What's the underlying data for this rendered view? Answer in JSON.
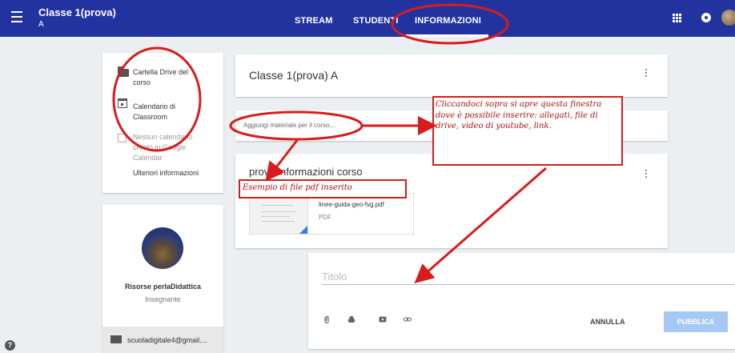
{
  "topbar": {
    "class_name": "Classe 1(prova)",
    "section": "A",
    "tabs": [
      {
        "label": "STREAM"
      },
      {
        "label": "STUDENTI"
      },
      {
        "label": "INFORMAZIONI",
        "active": true
      }
    ],
    "color": "#2233a0"
  },
  "sidebar": {
    "items": [
      {
        "label": "Cartella Drive del corso",
        "icon": "folder-icon"
      },
      {
        "label": "Calendario di Classroom",
        "icon": "calendar-icon"
      },
      {
        "label": "Nessun calendario creato in Google Calendar",
        "icon": "external-link-icon"
      },
      {
        "label": "Ulteriori informazioni"
      }
    ]
  },
  "teacher": {
    "name": "Risorse perlaDidattica",
    "role": "Insegnante",
    "email": "scuoladigitale4@gmail...."
  },
  "main": {
    "title": "Classe 1(prova) A",
    "add_placeholder": "Aggiungi materiale per il corso...",
    "info_title": "prova informazioni corso",
    "attachment": {
      "name": "linee-guida-geo-fvg.pdf",
      "type": "PDF"
    }
  },
  "compose": {
    "title_placeholder": "Titolo",
    "cancel": "ANNULLA",
    "publish": "PUBBLICA",
    "icons": [
      "attach-icon",
      "drive-icon",
      "youtube-icon",
      "link-icon"
    ]
  },
  "annotations": {
    "callout": "Cliccandoci sopra si apre questa finestra dove è possibile inserire: allegati, file di drive, video di youtube, link.",
    "example": "Esempio di file pdf inserito",
    "color": "#d81c1c"
  }
}
